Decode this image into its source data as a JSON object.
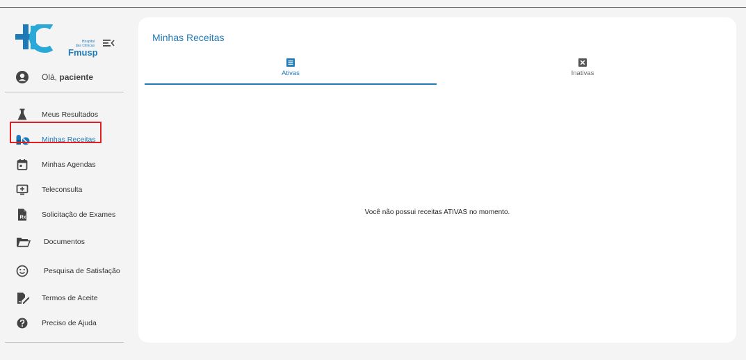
{
  "brand": {
    "logo_small_text": "Hospital\ndas Clínicas",
    "logo_name": "Fmusp",
    "colors": {
      "primary": "#1f7ab8",
      "accent": "#2aa8d8",
      "active_outline": "#e02020"
    }
  },
  "user": {
    "greeting": "Olá,",
    "name": "paciente"
  },
  "sidebar": {
    "items": [
      {
        "label": "Meus Resultados",
        "icon": "flask-icon"
      },
      {
        "label": "Minhas Receitas",
        "icon": "pills-icon",
        "active": true
      },
      {
        "label": "Minhas Agendas",
        "icon": "calendar-icon"
      },
      {
        "label": "Teleconsulta",
        "icon": "monitor-plus-icon"
      },
      {
        "label": "Solicitação de Exames",
        "icon": "prescription-doc-icon"
      },
      {
        "label": "Documentos",
        "icon": "folder-open-icon"
      },
      {
        "label": "Pesquisa de Satisfação",
        "icon": "smiley-icon"
      },
      {
        "label": "Termos de Aceite",
        "icon": "signature-icon"
      },
      {
        "label": "Preciso de Ajuda",
        "icon": "help-icon"
      }
    ]
  },
  "main": {
    "title": "Minhas Receitas",
    "tabs": [
      {
        "label": "Ativas",
        "icon": "list-icon",
        "active": true
      },
      {
        "label": "Inativas",
        "icon": "close-box-icon",
        "active": false
      }
    ],
    "empty_message": "Você não possui receitas ATIVAS no momento."
  }
}
